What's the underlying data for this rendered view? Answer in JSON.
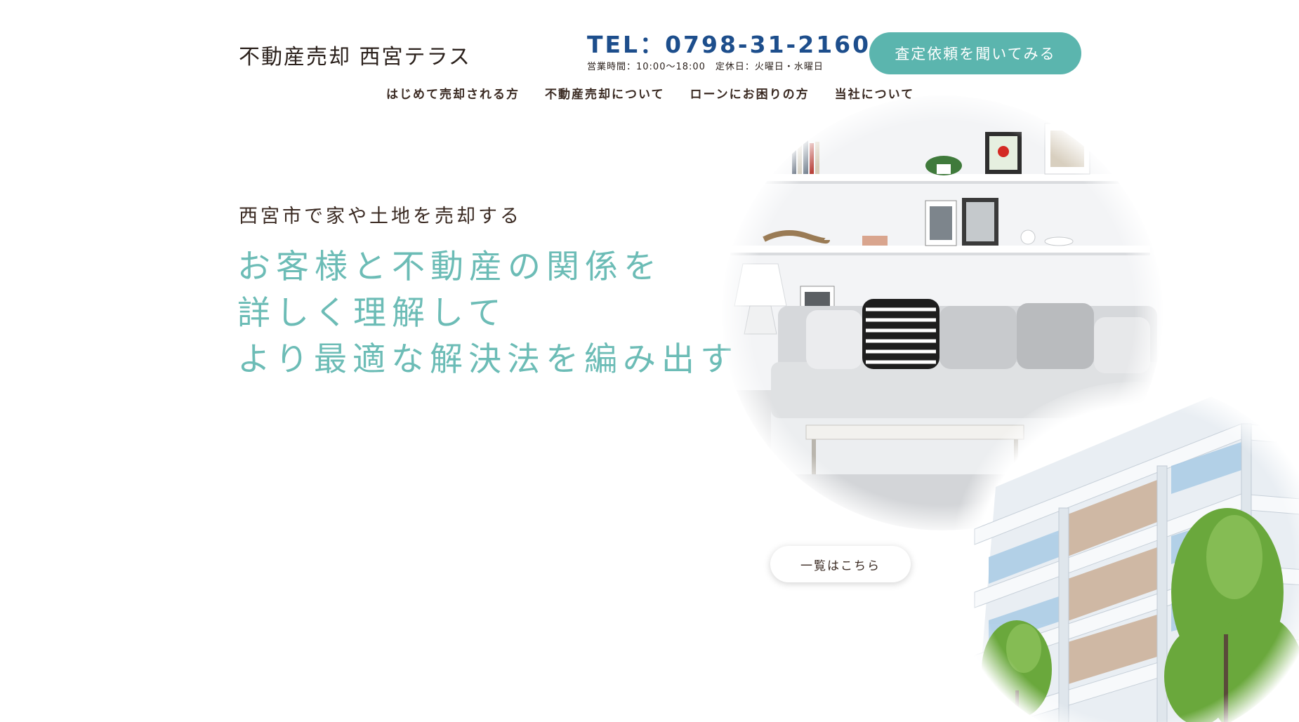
{
  "header": {
    "logo": "不動産売却 西宮テラス",
    "tel": "TEL：0798-31-2160",
    "hours": "営業時間：10:00〜18:00　定休日：火曜日・水曜日",
    "cta_label": "査定依頼を聞いてみる"
  },
  "nav": {
    "items": [
      {
        "label": "はじめて売却される方"
      },
      {
        "label": "不動産売却について"
      },
      {
        "label": "ローンにお困りの方"
      },
      {
        "label": "当社について"
      }
    ]
  },
  "hero": {
    "subtitle": "西宮市で家や土地を売却する",
    "title_lines": [
      "お客様と不動産の関係を",
      "詳しく理解して",
      "より最適な解決法を編み出す"
    ]
  },
  "images": {
    "room": "living-room-photo",
    "building": "apartment-building-photo"
  },
  "list_button": {
    "label": "一覧はこちら"
  },
  "colors": {
    "accent": "#5bb5ae",
    "title_text": "#6cbcb6",
    "tel_text": "#1d4e8c",
    "body_text": "#3a2a22"
  }
}
